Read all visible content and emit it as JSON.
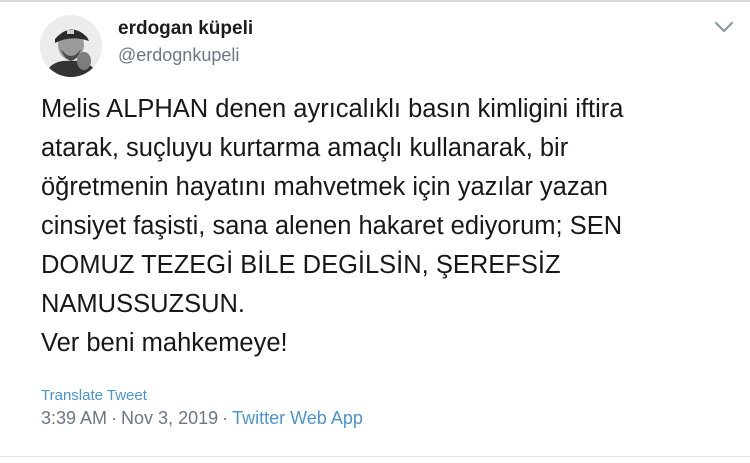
{
  "author": {
    "display_name": "erdogan küpeli",
    "handle": "@erdognkupeli"
  },
  "tweet": {
    "lines": [
      "Melis ALPHAN denen ayrıcalıklı basın kimligini iftira",
      "atarak, suçluyu kurtarma amaçlı kullanarak, bir",
      "öğretmenin hayatını mahvetmek için yazılar yazan",
      "cinsiyet faşisti, sana alenen hakaret ediyorum; SEN",
      "DOMUZ TEZEGİ BİLE DEGİLSİN, ŞEREFSİZ",
      "NAMUSSUZSUN.",
      "Ver beni mahkemeye!"
    ],
    "translate_label": "Translate Tweet",
    "time": "3:39 AM",
    "separator": "·",
    "date": "Nov 3, 2019",
    "source": "Twitter Web App"
  },
  "icons": {
    "more_menu": "chevron-down-icon",
    "avatar": "avatar"
  },
  "colors": {
    "link": "#4a94d4",
    "secondary_text": "#6b7785",
    "primary_text": "#16181a"
  }
}
